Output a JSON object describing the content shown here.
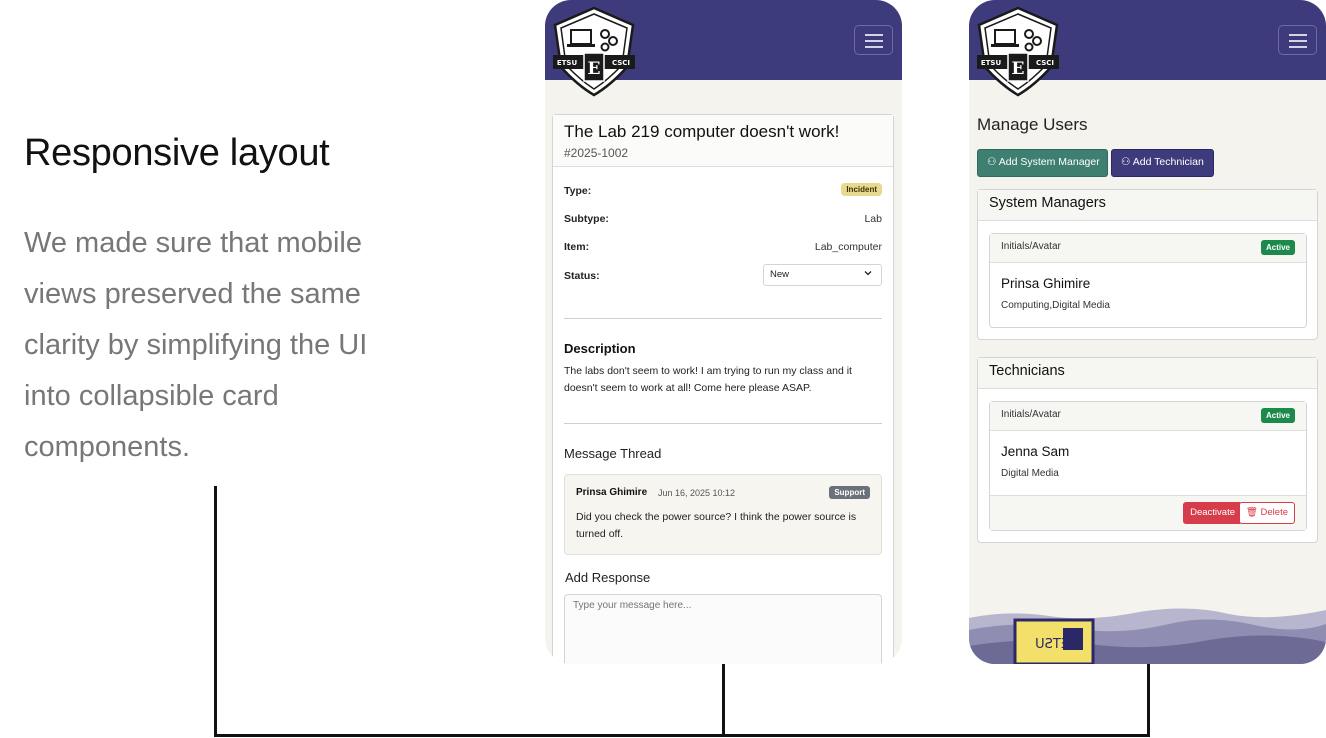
{
  "intro": {
    "title": "Responsive layout",
    "body": "We made sure that mobile views preserved the same clarity by simplifying the UI into collapsible card components."
  },
  "logo": {
    "left_text": "ETSU",
    "right_text": "CSCI",
    "letter": "E"
  },
  "ticket": {
    "title": "The Lab 219 computer doesn't work!",
    "id": "#2025-1002",
    "fields": {
      "type_label": "Type:",
      "type_value": "Incident",
      "subtype_label": "Subtype:",
      "subtype_value": "Lab",
      "item_label": "Item:",
      "item_value": "Lab_computer",
      "status_label": "Status:",
      "status_value": "New"
    },
    "description_heading": "Description",
    "description": "The labs don't seem to work! I am trying to run my class and it doesn't seem to work at all! Come here please ASAP.",
    "thread_heading": "Message Thread",
    "message": {
      "author": "Prinsa Ghimire",
      "time": "Jun 16, 2025 10:12",
      "role": "Support",
      "body": "Did you check the power source? I think the power source is turned off."
    },
    "add_response_heading": "Add Response",
    "response_placeholder": "Type your message here..."
  },
  "users": {
    "title": "Manage Users",
    "add_manager_label": "Add System Manager",
    "add_tech_label": "Add Technician",
    "managers_heading": "System Managers",
    "technicians_heading": "Technicians",
    "manager": {
      "header": "Initials/Avatar",
      "status": "Active",
      "name": "Prinsa Ghimire",
      "dept": "Computing,Digital Media"
    },
    "technician": {
      "header": "Initials/Avatar",
      "status": "Active",
      "name": "Jenna Sam",
      "dept": "Digital Media",
      "deactivate_label": "Deactivate",
      "delete_label": "Delete"
    },
    "footer_sign": "ETSU"
  },
  "colors": {
    "header_bg": "#3e3b7c",
    "page_bg": "#f4f3ee",
    "green_button": "#3f7f72",
    "active_badge": "#1b8a4a",
    "danger": "#d63c4a",
    "incident_badge": "#e7d98f"
  }
}
